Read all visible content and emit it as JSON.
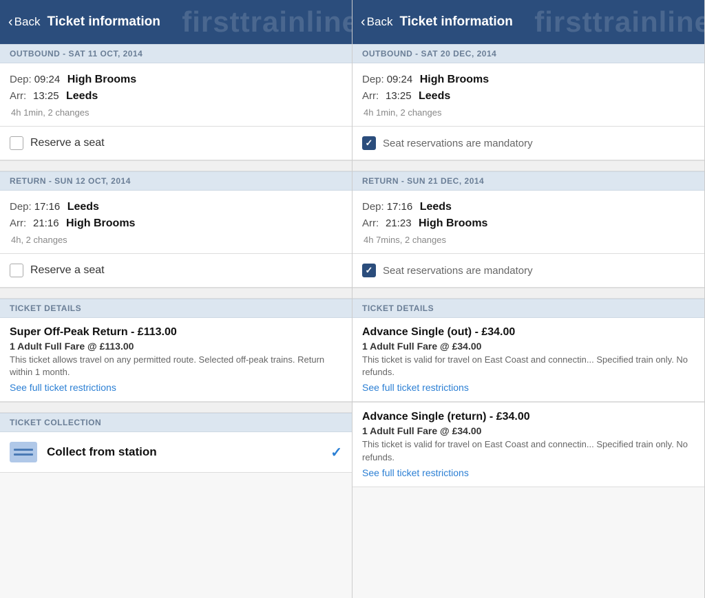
{
  "left": {
    "header": {
      "back_label": "Back",
      "title": "Ticket information",
      "watermark": "firsttrainline"
    },
    "outbound": {
      "section_label": "OUTBOUND - SAT 11 OCT, 2014",
      "dep_label": "Dep:",
      "dep_time": "09:24",
      "dep_station": "High Brooms",
      "arr_label": "Arr:",
      "arr_time": "13:25",
      "arr_station": "Leeds",
      "meta": "4h 1min, 2 changes",
      "reserve_label": "Reserve a seat",
      "checked": false
    },
    "return": {
      "section_label": "RETURN - SUN 12 OCT, 2014",
      "dep_label": "Dep:",
      "dep_time": "17:16",
      "dep_station": "Leeds",
      "arr_label": "Arr:",
      "arr_time": "21:16",
      "arr_station": "High Brooms",
      "meta": "4h, 2 changes",
      "reserve_label": "Reserve a seat",
      "checked": false
    },
    "ticket_details": {
      "section_label": "TICKET DETAILS",
      "ticket_name": "Super Off-Peak Return  - £113.00",
      "fare": "1 Adult Full Fare @ £113.00",
      "desc": "This ticket allows travel on any permitted route. Selected off-peak trains. Return within 1 month.",
      "link": "See full ticket restrictions"
    },
    "collection": {
      "section_label": "TICKET COLLECTION",
      "label": "Collect from station",
      "checked": true
    }
  },
  "right": {
    "header": {
      "back_label": "Back",
      "title": "Ticket information",
      "watermark": "firsttrainline"
    },
    "outbound": {
      "section_label": "OUTBOUND - SAT 20 DEC, 2014",
      "dep_label": "Dep:",
      "dep_time": "09:24",
      "dep_station": "High Brooms",
      "arr_label": "Arr:",
      "arr_time": "13:25",
      "arr_station": "Leeds",
      "meta": "4h 1min, 2 changes",
      "mandatory_label": "Seat reservations are mandatory",
      "checked": true
    },
    "return": {
      "section_label": "RETURN - SUN 21 DEC, 2014",
      "dep_label": "Dep:",
      "dep_time": "17:16",
      "dep_station": "Leeds",
      "arr_label": "Arr:",
      "arr_time": "21:23",
      "arr_station": "High Brooms",
      "meta": "4h 7mins, 2 changes",
      "mandatory_label": "Seat reservations are mandatory",
      "checked": true
    },
    "ticket_details": {
      "section_label": "TICKET DETAILS",
      "ticket1_name": "Advance Single (out)  - £34.00",
      "ticket1_fare": "1 Adult Full Fare @ £34.00",
      "ticket1_desc": "This ticket is valid for travel on East Coast and connectin... Specified train only. No refunds.",
      "ticket1_link": "See full ticket restrictions",
      "ticket2_name": "Advance Single (return)  - £34.00",
      "ticket2_fare": "1 Adult Full Fare @ £34.00",
      "ticket2_desc": "This ticket is valid for travel on East Coast and connectin... Specified train only. No refunds.",
      "ticket2_link": "See full ticket restrictions"
    }
  }
}
